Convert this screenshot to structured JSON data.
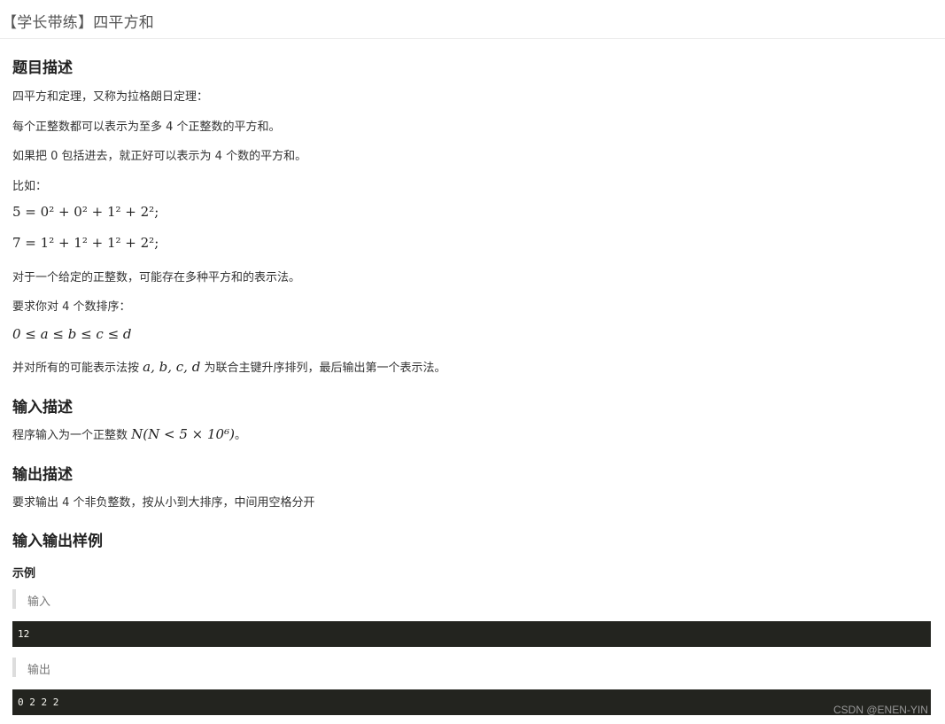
{
  "title": "【学长带练】四平方和",
  "sections": {
    "desc_heading": "题目描述",
    "desc_lines": [
      "四平方和定理，又称为拉格朗日定理：",
      "每个正整数都可以表示为至多 4 个正整数的平方和。",
      "如果把 0 包括进去，就正好可以表示为 4 个数的平方和。",
      "比如："
    ],
    "example_eq_1": "5 = 0² + 0² + 1² + 2²;",
    "example_eq_2": "7 = 1² + 1² + 1² + 2²;",
    "desc_lines_2": [
      "对于一个给定的正整数，可能存在多种平方和的表示法。",
      "要求你对 4 个数排序："
    ],
    "order_eq": "0 ≤ a ≤ b ≤ c ≤ d",
    "sort_text_before": "并对所有的可能表示法按",
    "sort_vars": "a, b, c, d",
    "sort_text_after": "为联合主键升序排列，最后输出第一个表示法。",
    "input_heading": "输入描述",
    "input_text": "程序输入为一个正整数",
    "input_math": "N(N < 5 × 10⁶)",
    "input_end": "。",
    "output_heading": "输出描述",
    "output_text": "要求输出 4 个非负整数，按从小到大排序，中间用空格分开",
    "io_heading": "输入输出样例",
    "example_label": "示例",
    "input_label": "输入",
    "input_code": "12",
    "output_label": "输出",
    "output_code": "0 2 2 2"
  },
  "watermark": "CSDN @ENEN-YIN"
}
